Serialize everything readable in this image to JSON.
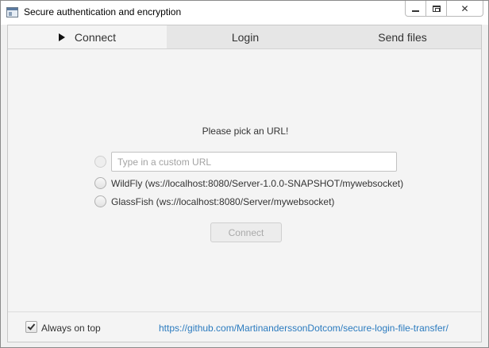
{
  "window": {
    "title": "Secure authentication and encryption",
    "close_glyph": "✕"
  },
  "tabs": [
    {
      "label": "Connect",
      "active": true,
      "icon": "play-icon"
    },
    {
      "label": "Login",
      "active": false
    },
    {
      "label": "Send files",
      "active": false
    }
  ],
  "connect": {
    "prompt": "Please pick an URL!",
    "custom_url": {
      "value": "",
      "placeholder": "Type in a custom URL"
    },
    "options": [
      {
        "label": "WildFly (ws://localhost:8080/Server-1.0.0-SNAPSHOT/mywebsocket)",
        "selected": false
      },
      {
        "label": "GlassFish (ws://localhost:8080/Server/mywebsocket)",
        "selected": false
      }
    ],
    "connect_button": "Connect"
  },
  "footer": {
    "always_on_top_label": "Always on top",
    "always_on_top_checked": true,
    "repo_link": "https://github.com/MartinanderssonDotcom/secure-login-file-transfer/"
  },
  "colors": {
    "link": "#2b7bbf",
    "window_background": "#f4f4f4",
    "tab_bar": "#e6e6e6",
    "disabled_text": "#a9a9a9"
  }
}
